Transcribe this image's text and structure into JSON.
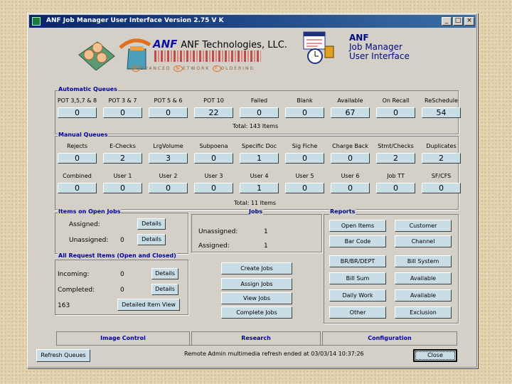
{
  "window": {
    "title": "ANF Job Manager User Interface Version 2.75 V K",
    "controls": [
      "_",
      "□",
      "×"
    ]
  },
  "header": {
    "company": "ANF Technologies, LLC.",
    "tagline": [
      "DVANCED",
      "ETWORK",
      "OLDERING"
    ],
    "tagline_letters": [
      "A",
      "N",
      "F"
    ],
    "product_lines": [
      "ANF",
      "Job Manager",
      "User Interface"
    ]
  },
  "automatic_queues": {
    "label": "Automatic Queues",
    "items": [
      {
        "label": "POT 3,5,7 & 8",
        "value": "0"
      },
      {
        "label": "POT 3 & 7",
        "value": "0"
      },
      {
        "label": "POT 5 & 6",
        "value": "0"
      },
      {
        "label": "POT 10",
        "value": "22"
      },
      {
        "label": "Failed",
        "value": "0"
      },
      {
        "label": "Blank",
        "value": "0"
      },
      {
        "label": "Available",
        "value": "67"
      },
      {
        "label": "On Recall",
        "value": "0"
      },
      {
        "label": "ReSchedule",
        "value": "54"
      }
    ],
    "total": "Total: 143 Items"
  },
  "manual_queues": {
    "label": "Manual Queues",
    "row1": [
      {
        "label": "Rejects",
        "value": "0"
      },
      {
        "label": "E-Checks",
        "value": "2"
      },
      {
        "label": "LrgVolume",
        "value": "3"
      },
      {
        "label": "Subpoena",
        "value": "0"
      },
      {
        "label": "Specific Doc",
        "value": "1"
      },
      {
        "label": "Sig Fiche",
        "value": "0"
      },
      {
        "label": "Charge Back",
        "value": "0"
      },
      {
        "label": "Stmt/Checks",
        "value": "2"
      },
      {
        "label": "Duplicates",
        "value": "2"
      }
    ],
    "row2": [
      {
        "label": "Combined",
        "value": "0"
      },
      {
        "label": "User 1",
        "value": "0"
      },
      {
        "label": "User 2",
        "value": "0"
      },
      {
        "label": "User 3",
        "value": "0"
      },
      {
        "label": "User 4",
        "value": "1"
      },
      {
        "label": "User 5",
        "value": "0"
      },
      {
        "label": "User 6",
        "value": "0"
      },
      {
        "label": "Job TT",
        "value": "0"
      },
      {
        "label": "SF/CFS",
        "value": "0"
      }
    ],
    "total": "Total: 11 Items"
  },
  "open_jobs": {
    "label": "Items on Open Jobs",
    "rows": [
      {
        "label": "Assigned:",
        "value": "",
        "button": "Details"
      },
      {
        "label": "Unassigned:",
        "value": "0",
        "button": "Details"
      }
    ]
  },
  "all_requests": {
    "label": "All Request Items (Open and Closed)",
    "rows": [
      {
        "label": "Incoming:",
        "value": "0",
        "button": "Details"
      },
      {
        "label": "Completed:",
        "value": "0",
        "button": "Details"
      }
    ],
    "count": "163",
    "view_button": "Detailed Item View"
  },
  "jobs": {
    "label": "Jobs",
    "rows": [
      {
        "label": "Unassigned:",
        "value": "1"
      },
      {
        "label": "Assigned:",
        "value": "1"
      }
    ],
    "buttons": [
      "Create Jobs",
      "Assign Jobs",
      "View Jobs",
      "Complete Jobs"
    ]
  },
  "reports": {
    "label": "Reports",
    "left": [
      "Open Items",
      "Bar Code",
      "BR/BR/DEPT",
      "Bill Sum",
      "Daily Work",
      "Other"
    ],
    "right": [
      "Customer",
      "Channel",
      "Bill System",
      "Available",
      "Available",
      "Exclusion"
    ]
  },
  "tabs": [
    "Image Control",
    "Research",
    "Configuration"
  ],
  "footer": {
    "refresh": "Refresh Queues",
    "status": "Remote Admin multimedia refresh ended at 03/03/14 10:37:26",
    "close": "Close"
  }
}
